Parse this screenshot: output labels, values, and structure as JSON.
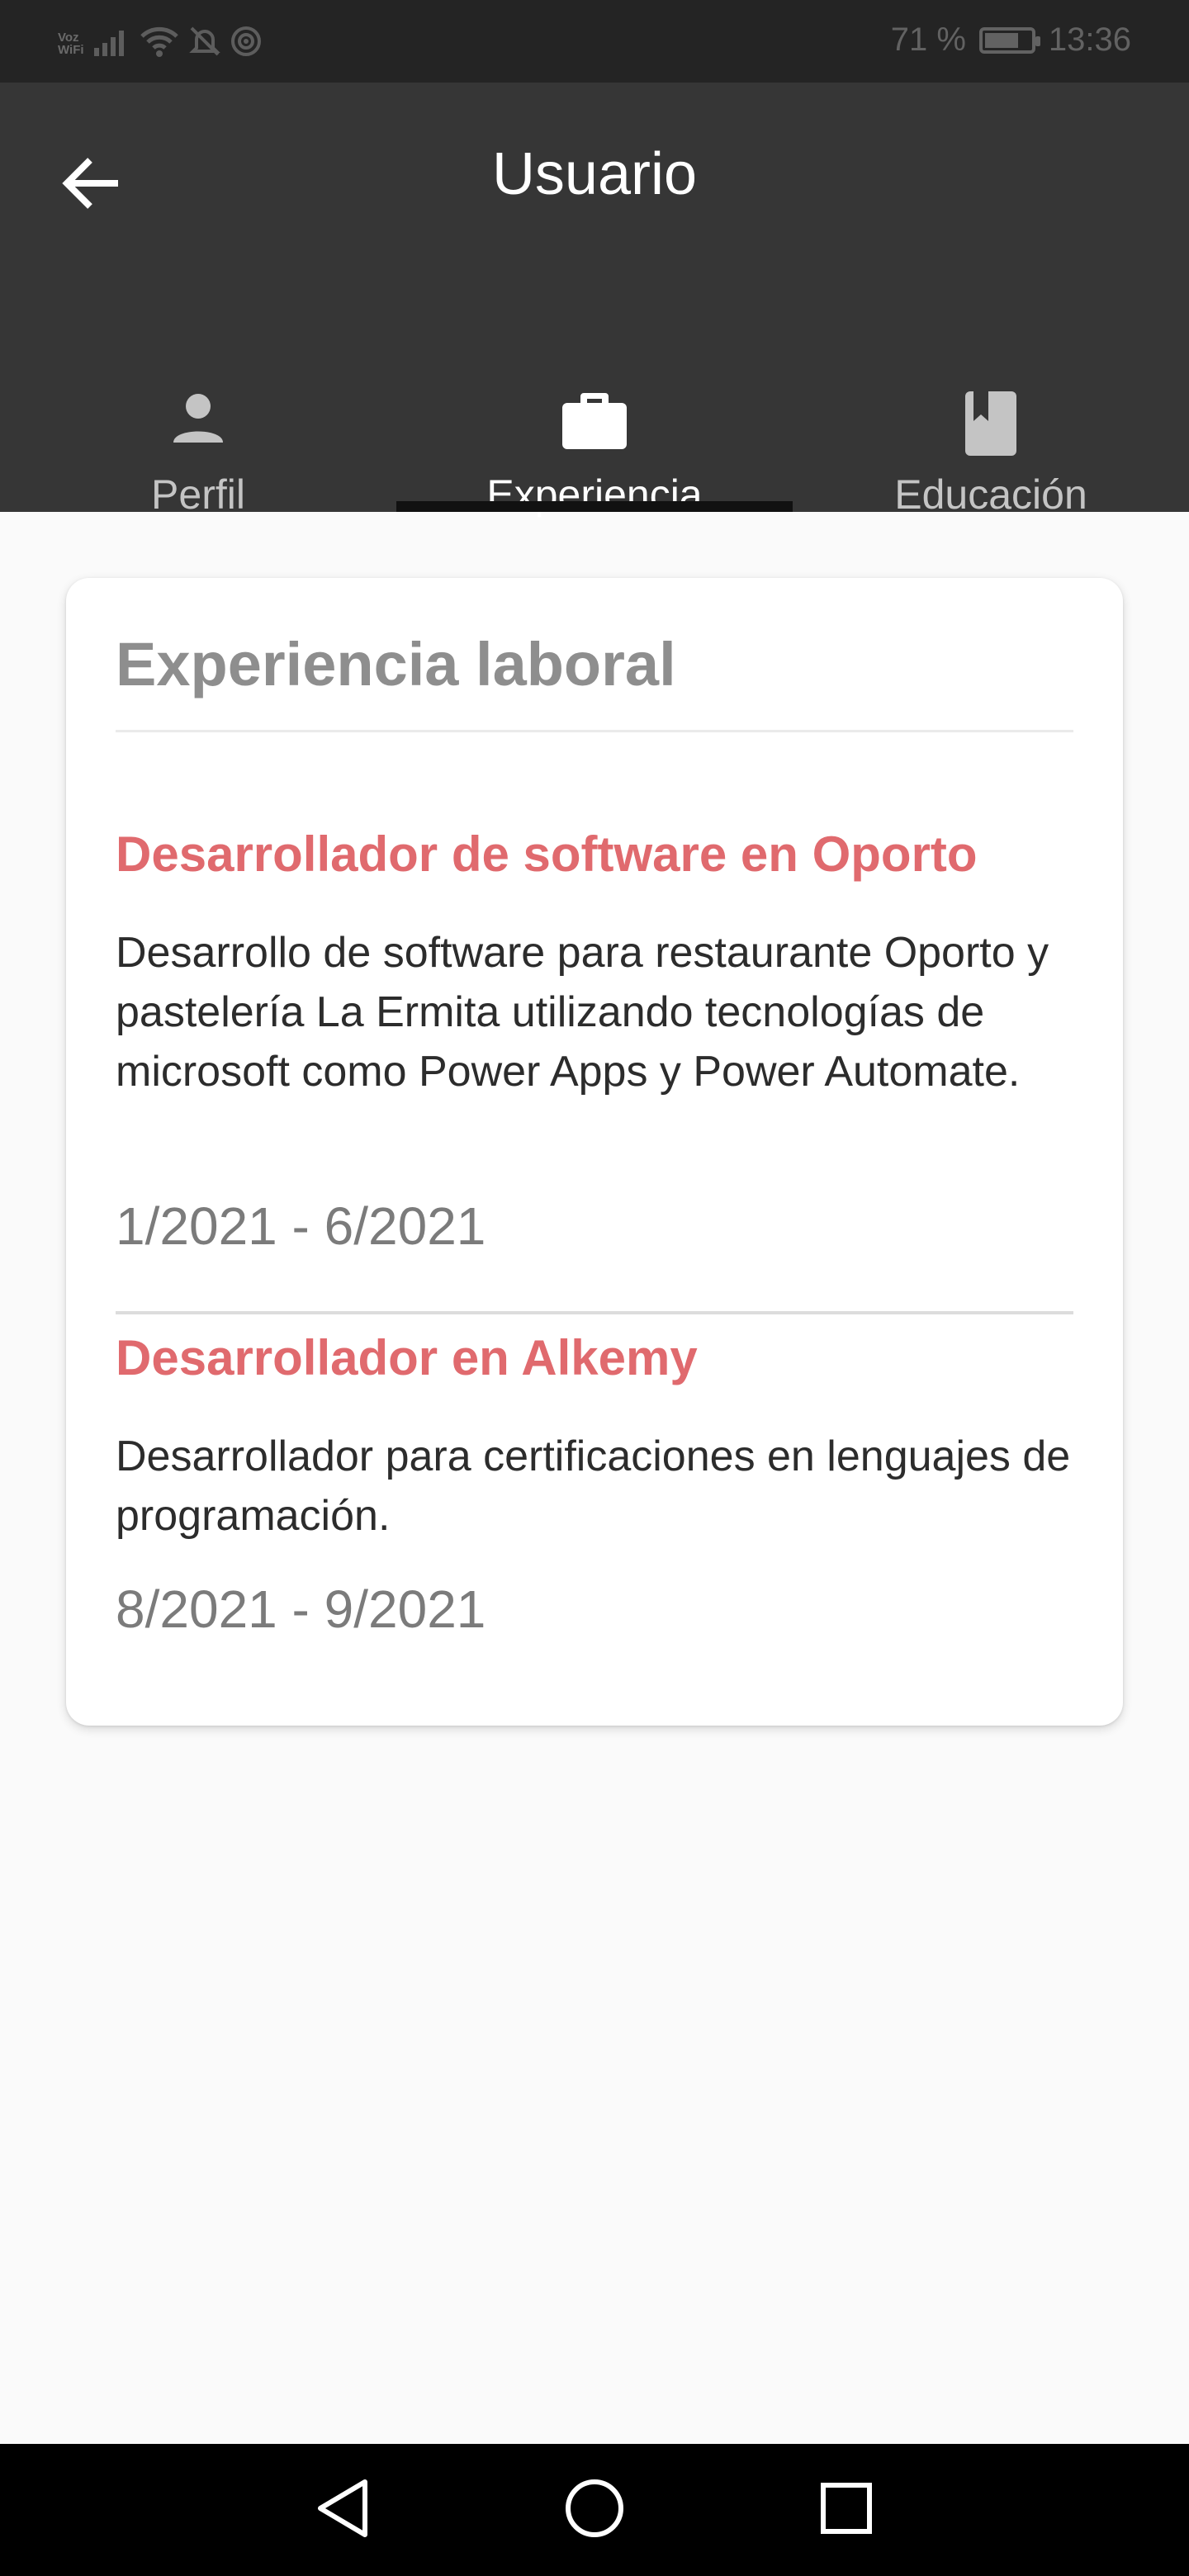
{
  "status_bar": {
    "carrier_voz": "Voz",
    "carrier_wifi": "WiFi",
    "battery": "71 %",
    "time": "13:36",
    "icons": [
      "signal-icon",
      "wifi-icon",
      "bell-off-icon",
      "hotspot-icon",
      "battery-icon"
    ]
  },
  "app_bar": {
    "title": "Usuario",
    "back_icon": "arrow-left-icon"
  },
  "tabs": [
    {
      "label": "Perfil",
      "icon": "person-icon",
      "active": false
    },
    {
      "label": "Experiencia",
      "icon": "briefcase-icon",
      "active": true
    },
    {
      "label": "Educación",
      "icon": "book-icon",
      "active": false
    }
  ],
  "card": {
    "title": "Experiencia laboral",
    "items": [
      {
        "title": "Desarrollador de software en Oporto",
        "description": "Desarrollo de software para restaurante Oporto y pastelería La Ermita utilizando tecnologías de microsoft como Power Apps y Power Automate.",
        "date": "1/2021 - 6/2021"
      },
      {
        "title": "Desarrollador en Alkemy",
        "description": "Desarrollador para certificaciones en lenguajes de programación.",
        "date": "8/2021 - 9/2021"
      }
    ]
  },
  "colors": {
    "app_bar": "#363636",
    "status_bar": "#242424",
    "accent_title": "#e06a6e",
    "card_title": "#8e8e8e"
  },
  "nav_bar": {
    "icons": [
      "back-triangle-icon",
      "home-circle-icon",
      "recents-square-icon"
    ]
  }
}
